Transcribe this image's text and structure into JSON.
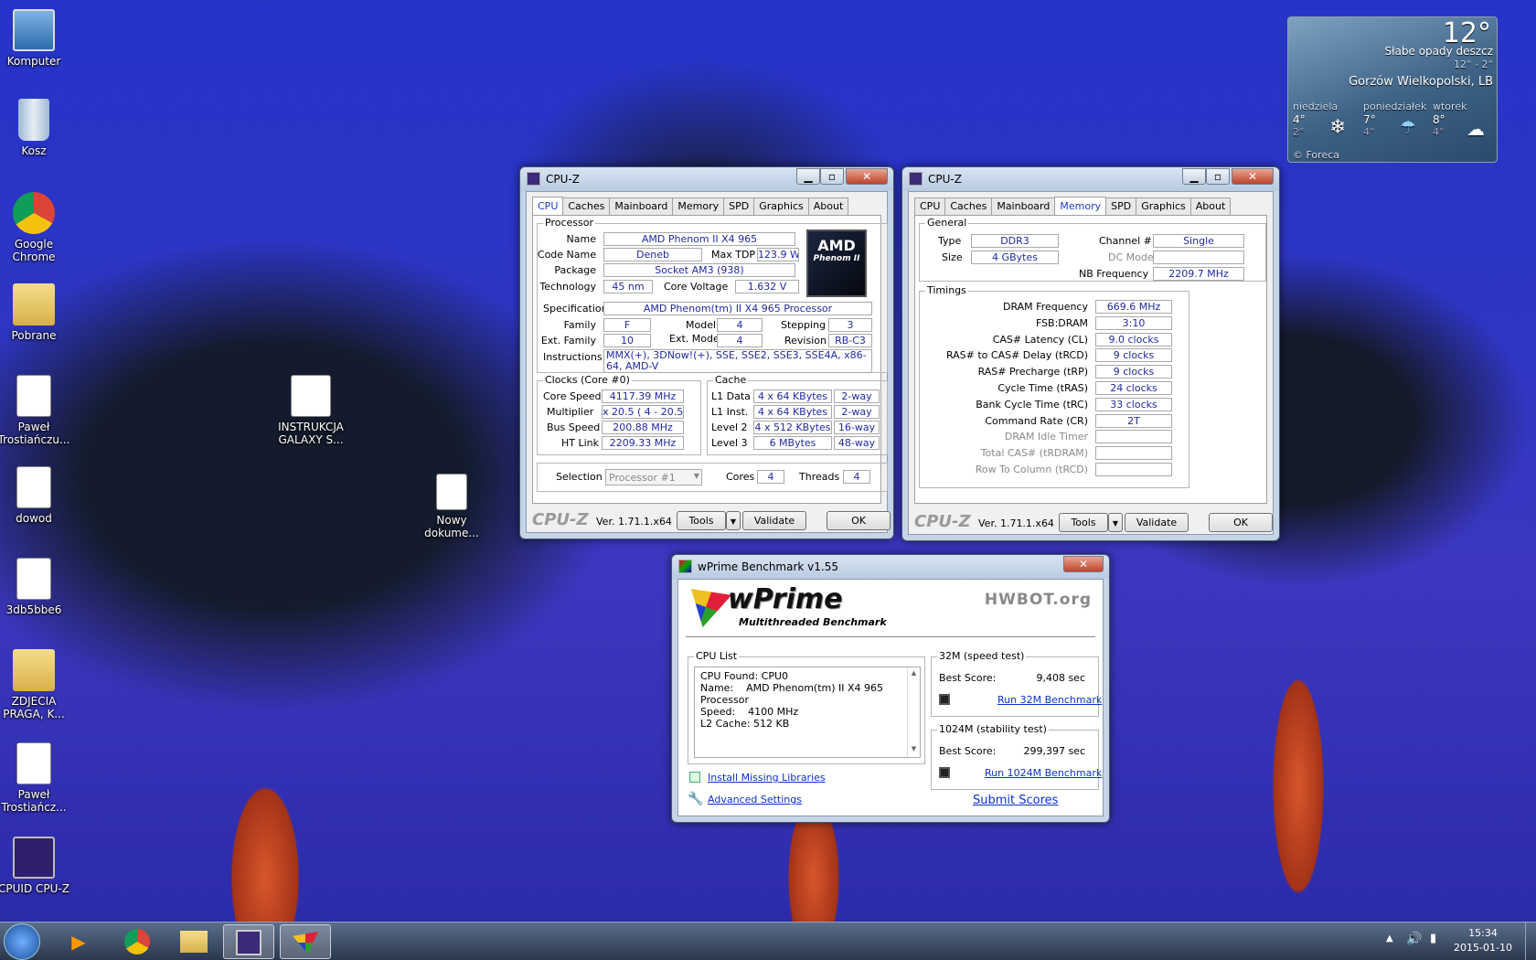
{
  "desktop": {
    "icons": [
      {
        "label": "Komputer"
      },
      {
        "label": "Kosz"
      },
      {
        "label": "Google Chrome"
      },
      {
        "label": "Pobrane"
      },
      {
        "label": "Paweł Trostiańczu..."
      },
      {
        "label": "dowod"
      },
      {
        "label": "3db5bbe6"
      },
      {
        "label": "ZDJECIA PRAGA, K..."
      },
      {
        "label": "Paweł Trostiańcz..."
      },
      {
        "label": "CPUID CPU-Z"
      },
      {
        "label": "INSTRUKCJA GALAXY S..."
      },
      {
        "label": "Nowy dokume..."
      }
    ]
  },
  "weather": {
    "temp": "12°",
    "desc": "Słabe opady deszcz",
    "range": "12° - 2°",
    "location": "Gorzów Wielkopolski, LB",
    "days": [
      {
        "name": "niedziela",
        "hi": "4°",
        "lo": "2°"
      },
      {
        "name": "poniedziałek",
        "hi": "7°",
        "lo": "4°"
      },
      {
        "name": "wtorek",
        "hi": "8°",
        "lo": "4°"
      }
    ],
    "credit": "© Foreca"
  },
  "cpuz_cpu": {
    "title": "CPU-Z",
    "tabs": [
      "CPU",
      "Caches",
      "Mainboard",
      "Memory",
      "SPD",
      "Graphics",
      "About"
    ],
    "active_tab": "CPU",
    "processor": {
      "group": "Processor",
      "name_l": "Name",
      "name": "AMD Phenom II X4 965",
      "codename_l": "Code Name",
      "codename": "Deneb",
      "maxtdp_l": "Max TDP",
      "maxtdp": "123.9 W",
      "package_l": "Package",
      "package": "Socket AM3 (938)",
      "tech_l": "Technology",
      "tech": "45 nm",
      "cv_l": "Core Voltage",
      "cv": "1.632 V",
      "spec_l": "Specification",
      "spec": "AMD Phenom(tm) II X4 965 Processor",
      "family_l": "Family",
      "family": "F",
      "model_l": "Model",
      "model": "4",
      "stepping_l": "Stepping",
      "stepping": "3",
      "extfam_l": "Ext. Family",
      "extfam": "10",
      "extmodel_l": "Ext. Model",
      "extmodel": "4",
      "rev_l": "Revision",
      "rev": "RB-C3",
      "instr_l": "Instructions",
      "instr": "MMX(+), 3DNow!(+), SSE, SSE2, SSE3, SSE4A, x86-64, AMD-V",
      "logo1": "AMD",
      "logo2": "Phenom II"
    },
    "clocks": {
      "group": "Clocks (Core #0)",
      "cs_l": "Core Speed",
      "cs": "4117.39 MHz",
      "mul_l": "Multiplier",
      "mul": "x 20.5 ( 4 - 20.5 )",
      "bus_l": "Bus Speed",
      "bus": "200.88 MHz",
      "ht_l": "HT Link",
      "ht": "2209.33 MHz"
    },
    "cache": {
      "group": "Cache",
      "l1d_l": "L1 Data",
      "l1d": "4 x 64 KBytes",
      "l1d_w": "2-way",
      "l1i_l": "L1 Inst.",
      "l1i": "4 x 64 KBytes",
      "l1i_w": "2-way",
      "l2_l": "Level 2",
      "l2": "4 x 512 KBytes",
      "l2_w": "16-way",
      "l3_l": "Level 3",
      "l3": "6 MBytes",
      "l3_w": "48-way"
    },
    "sel_l": "Selection",
    "sel": "Processor #1",
    "cores_l": "Cores",
    "cores": "4",
    "threads_l": "Threads",
    "threads": "4"
  },
  "cpuz_mem": {
    "title": "CPU-Z",
    "tabs": [
      "CPU",
      "Caches",
      "Mainboard",
      "Memory",
      "SPD",
      "Graphics",
      "About"
    ],
    "active_tab": "Memory",
    "general": {
      "group": "General",
      "type_l": "Type",
      "type": "DDR3",
      "size_l": "Size",
      "size": "4 GBytes",
      "ch_l": "Channel #",
      "ch": "Single",
      "dc_l": "DC Mode",
      "dc": "",
      "nb_l": "NB Frequency",
      "nb": "2209.7 MHz"
    },
    "timings": {
      "group": "Timings",
      "rows": [
        {
          "l": "DRAM Frequency",
          "v": "669.6 MHz"
        },
        {
          "l": "FSB:DRAM",
          "v": "3:10"
        },
        {
          "l": "CAS# Latency (CL)",
          "v": "9.0 clocks"
        },
        {
          "l": "RAS# to CAS# Delay (tRCD)",
          "v": "9 clocks"
        },
        {
          "l": "RAS# Precharge (tRP)",
          "v": "9 clocks"
        },
        {
          "l": "Cycle Time (tRAS)",
          "v": "24 clocks"
        },
        {
          "l": "Bank Cycle Time (tRC)",
          "v": "33 clocks"
        },
        {
          "l": "Command Rate (CR)",
          "v": "2T"
        },
        {
          "l": "DRAM Idle Timer",
          "v": ""
        },
        {
          "l": "Total CAS# (tRDRAM)",
          "v": ""
        },
        {
          "l": "Row To Column (tRCD)",
          "v": ""
        }
      ]
    }
  },
  "footer": {
    "brand": "CPU-Z",
    "ver": "Ver. 1.71.1.x64",
    "tools": "Tools",
    "validate": "Validate",
    "ok": "OK"
  },
  "wprime": {
    "title": "wPrime Benchmark v1.55",
    "logo": "wPrime",
    "sub": "Multithreaded Benchmark",
    "hwbot": "HWBOT.org",
    "cpulist": "CPU List",
    "cpu_lines": [
      "CPU Found: CPU0",
      "Name:    AMD Phenom(tm) II X4 965",
      "Processor",
      "Speed:    4100 MHz",
      "L2 Cache: 512 KB"
    ],
    "t32": "32M (speed test)",
    "best_l": "Best Score:",
    "best32": "9,408 sec",
    "run32": "Run 32M Benchmark",
    "t1024": "1024M (stability test)",
    "best1024": "299,397 sec",
    "run1024": "Run 1024M Benchmark",
    "install": "Install Missing Libraries",
    "advanced": "Advanced Settings",
    "submit": "Submit Scores"
  },
  "taskbar": {
    "time": "15:34",
    "date": "2015-01-10"
  }
}
